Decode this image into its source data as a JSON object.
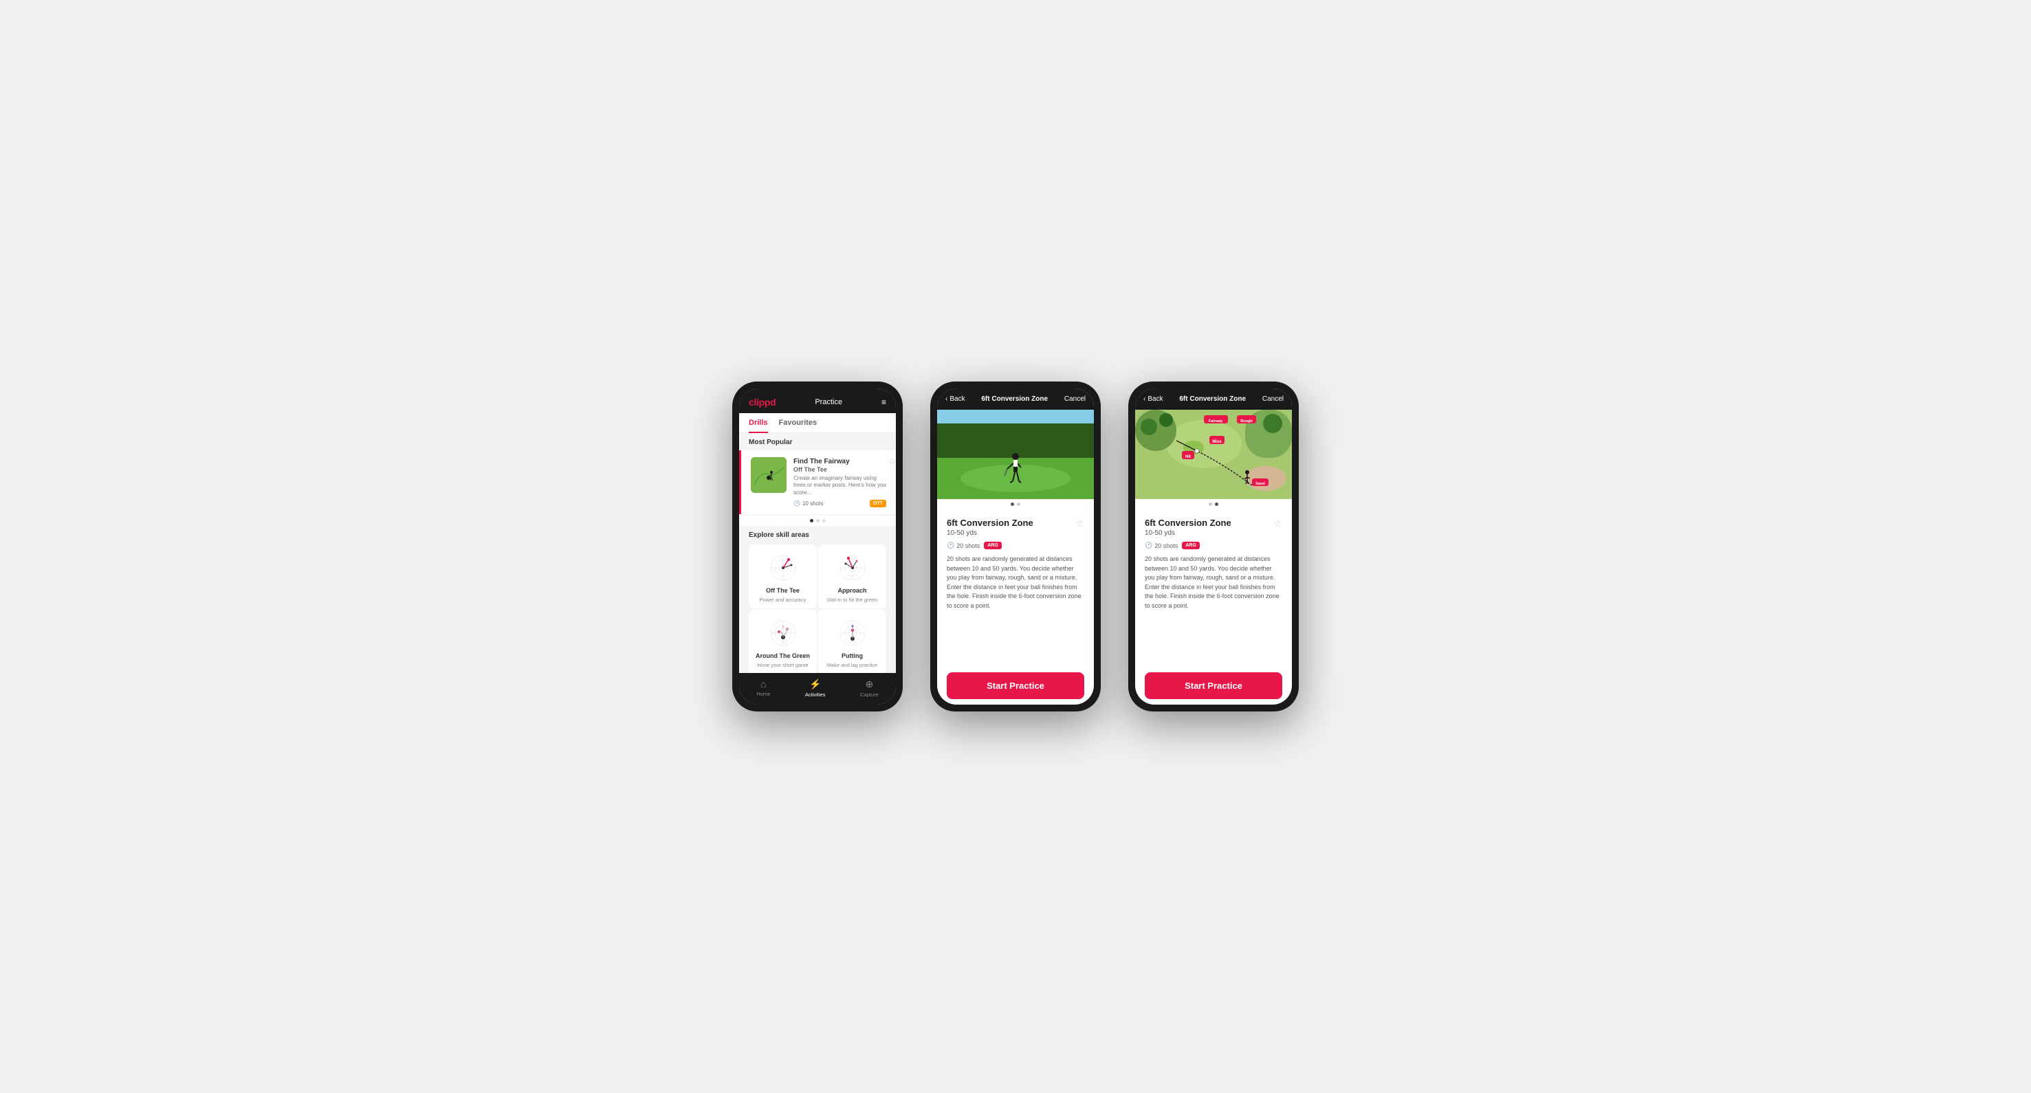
{
  "phone1": {
    "header": {
      "logo": "clippd",
      "title": "Practice",
      "menu_icon": "≡"
    },
    "tabs": [
      {
        "label": "Drills",
        "active": true
      },
      {
        "label": "Favourites",
        "active": false
      }
    ],
    "most_popular_label": "Most Popular",
    "featured_drill": {
      "title": "Find The Fairway",
      "subtitle": "Off The Tee",
      "description": "Create an imaginary fairway using trees or marker posts. Here's how you score...",
      "shots": "10 shots",
      "tag": "OTT",
      "tag_color": "ott"
    },
    "explore_label": "Explore skill areas",
    "skill_areas": [
      {
        "name": "Off The Tee",
        "desc": "Power and accuracy"
      },
      {
        "name": "Approach",
        "desc": "Dial-in to hit the green"
      },
      {
        "name": "Around The Green",
        "desc": "Hone your short game"
      },
      {
        "name": "Putting",
        "desc": "Make and lag practice"
      }
    ],
    "nav": [
      {
        "label": "Home",
        "icon": "⌂",
        "active": false
      },
      {
        "label": "Activities",
        "icon": "⚡",
        "active": true
      },
      {
        "label": "Capture",
        "icon": "⊕",
        "active": false
      }
    ]
  },
  "phone2": {
    "header": {
      "back": "Back",
      "title": "6ft Conversion Zone",
      "cancel": "Cancel"
    },
    "drill_title": "6ft Conversion Zone",
    "drill_range": "10-50 yds",
    "shots": "20 shots",
    "tag": "ARG",
    "description": "20 shots are randomly generated at distances between 10 and 50 yards. You decide whether you play from fairway, rough, sand or a mixture. Enter the distance in feet your ball finishes from the hole. Finish inside the 6-foot conversion zone to score a point.",
    "start_btn": "Start Practice",
    "image_type": "photo"
  },
  "phone3": {
    "header": {
      "back": "Back",
      "title": "6ft Conversion Zone",
      "cancel": "Cancel"
    },
    "drill_title": "6ft Conversion Zone",
    "drill_range": "10-50 yds",
    "shots": "20 shots",
    "tag": "ARG",
    "description": "20 shots are randomly generated at distances between 10 and 50 yards. You decide whether you play from fairway, rough, sand or a mixture. Enter the distance in feet your ball finishes from the hole. Finish inside the 6-foot conversion zone to score a point.",
    "start_btn": "Start Practice",
    "image_type": "map",
    "map_labels": [
      "Fairway",
      "Rough",
      "Miss",
      "Hit",
      "Sand"
    ]
  },
  "colors": {
    "brand_red": "#e8174a",
    "dark_bg": "#1a1a1a",
    "tag_ott": "#ff9800",
    "tag_arg": "#e8174a"
  }
}
